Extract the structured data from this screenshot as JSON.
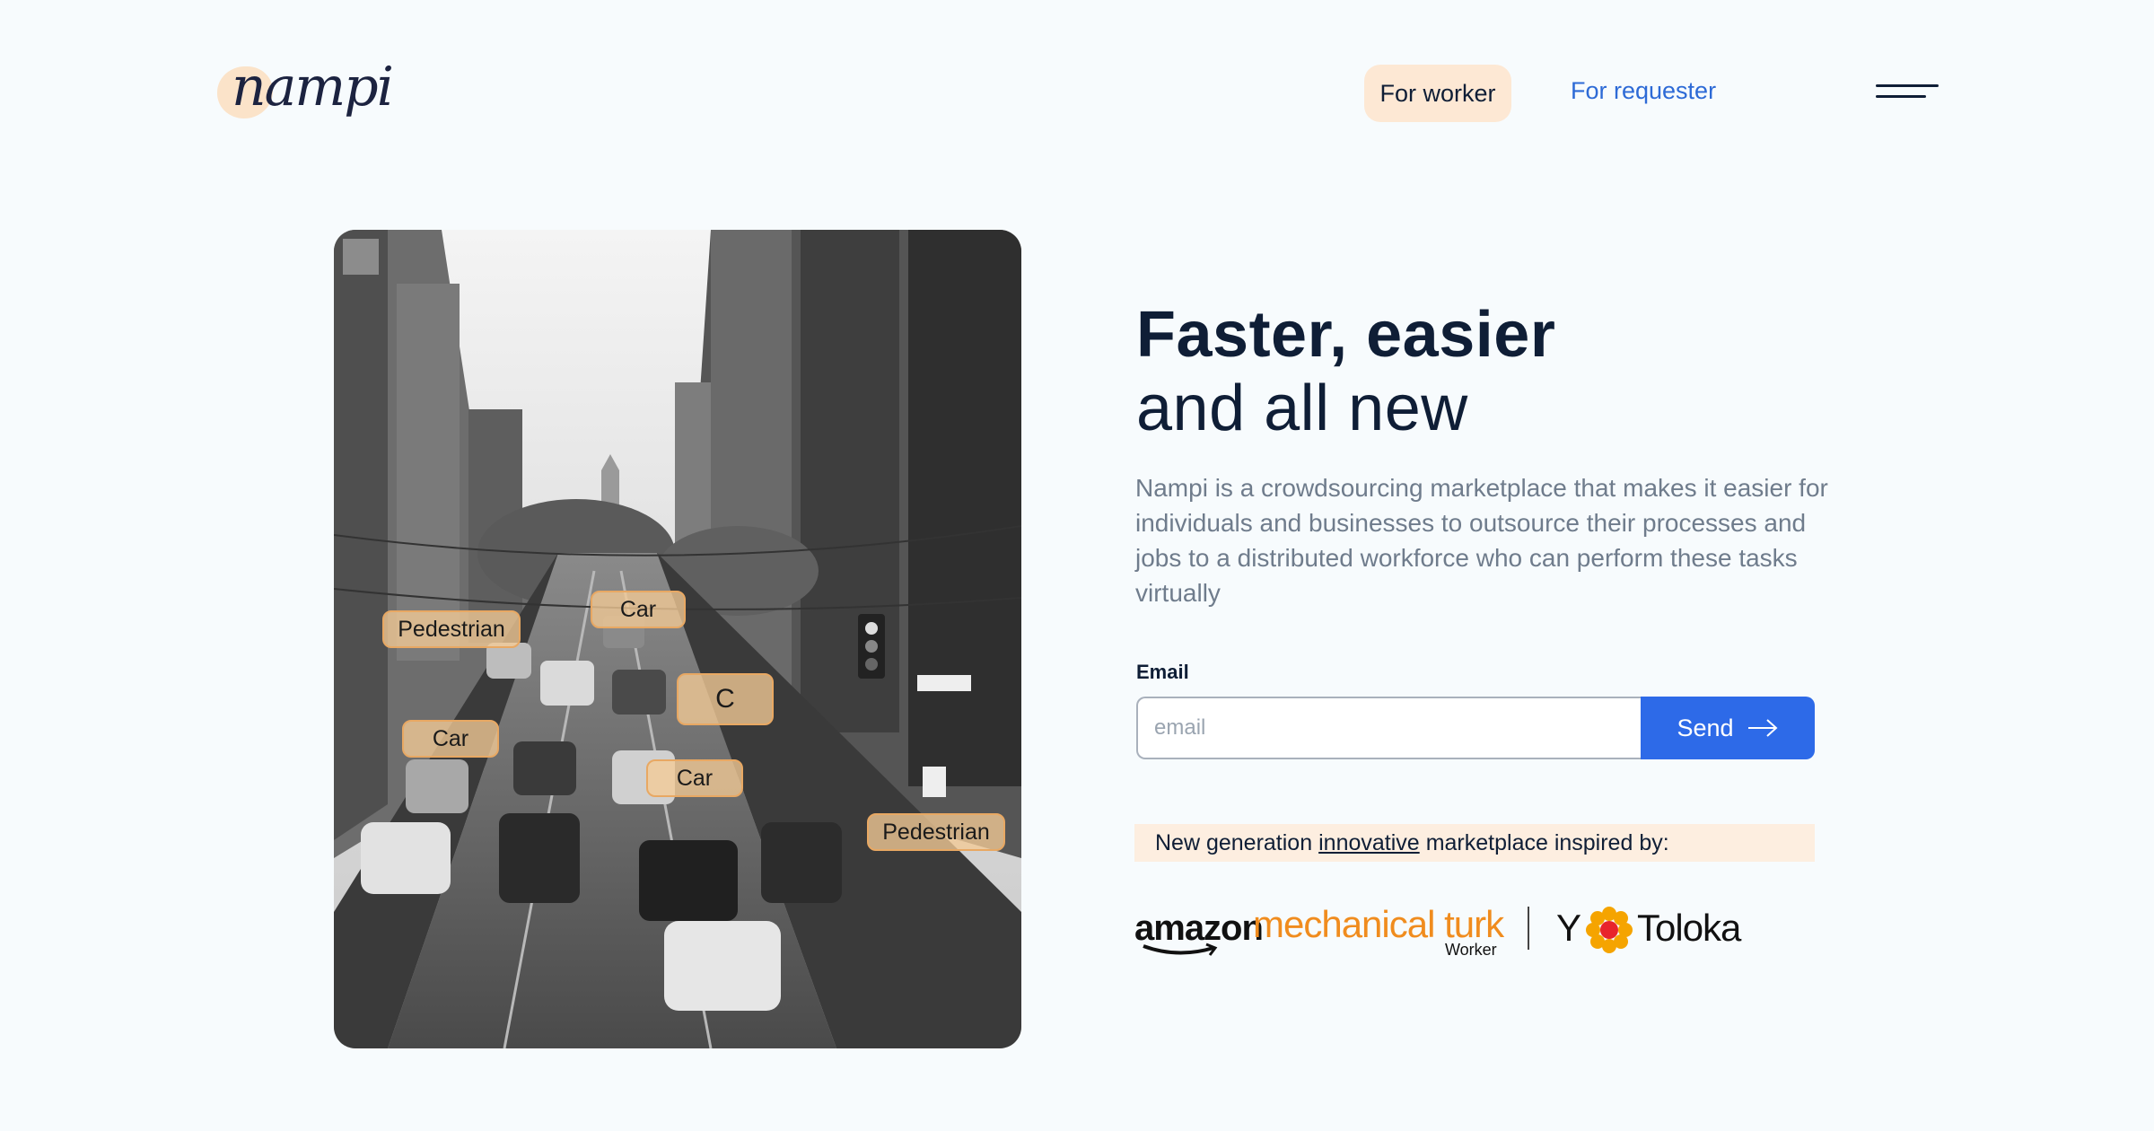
{
  "header": {
    "logo_text": "nampi",
    "nav": {
      "worker_label": "For worker",
      "requester_label": "For requester"
    },
    "menu_icon": "menu-icon"
  },
  "hero": {
    "image_description_icon": "street-scene-image",
    "tags": [
      {
        "label": "Pedestrian"
      },
      {
        "label": "Car"
      },
      {
        "label": "C"
      },
      {
        "label": "Car"
      },
      {
        "label": "Car"
      },
      {
        "label": "Pedestrian"
      }
    ]
  },
  "main": {
    "headline_bold": "Faster, easier",
    "headline_regular": "and all new",
    "description": "Nampi is a crowdsourcing marketplace that makes it easier for individuals and businesses to outsource their processes and jobs to a distributed workforce who can perform these tasks virtually",
    "form": {
      "email_label": "Email",
      "email_placeholder": "email",
      "email_value": "",
      "send_label": "Send",
      "send_icon": "arrow-right-icon"
    },
    "inspired": {
      "prefix": "New generation",
      "link": "innovative",
      "suffix": "marketplace inspired by:"
    },
    "partners": {
      "amazon": "amazon",
      "mturk": "mechanical turk",
      "mturk_sub": "Worker",
      "yandex": "Y",
      "toloka": "Toloka"
    }
  },
  "colors": {
    "background": "#f7fbfd",
    "accent_blue": "#2d6ae8",
    "accent_peach": "#fde8d4",
    "text_dark": "#0f1e36",
    "text_muted": "#6f7c8c",
    "mturk_orange": "#f08c1e"
  }
}
